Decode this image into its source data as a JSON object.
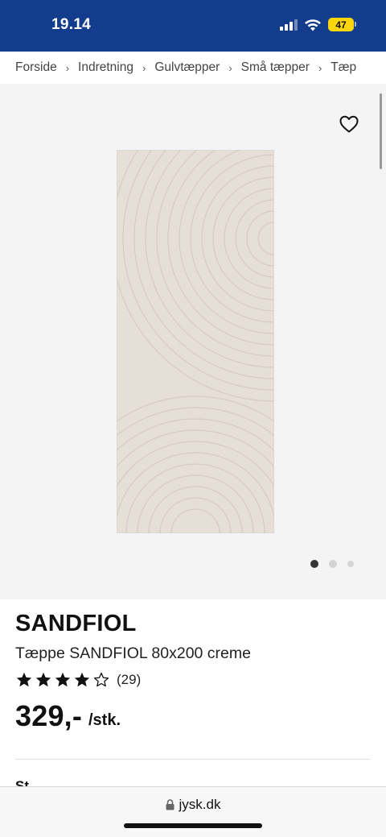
{
  "status": {
    "time": "19.14",
    "battery": "47",
    "icons": [
      "signal-icon",
      "wifi-icon",
      "battery-icon"
    ]
  },
  "breadcrumb": [
    "Forside",
    "Indretning",
    "Gulvtæpper",
    "Små tæpper",
    "Tæp"
  ],
  "gallery": {
    "favorite_icon": "heart-icon",
    "image": "rug-product-image",
    "current_slide": 1,
    "slide_count": 3
  },
  "product": {
    "brand": "SANDFIOL",
    "description": "Tæppe SANDFIOL 80x200 creme",
    "rating": 4,
    "rating_max": 5,
    "review_count": "(29)",
    "price": "329,-",
    "unit": "/stk.",
    "next_section": "St"
  },
  "browser": {
    "url": "jysk.dk"
  },
  "colors": {
    "header_bg": "#143c8c",
    "gallery_bg": "#f4f4f4",
    "rug": "#e6dfd8",
    "battery": "#ffd60a"
  }
}
